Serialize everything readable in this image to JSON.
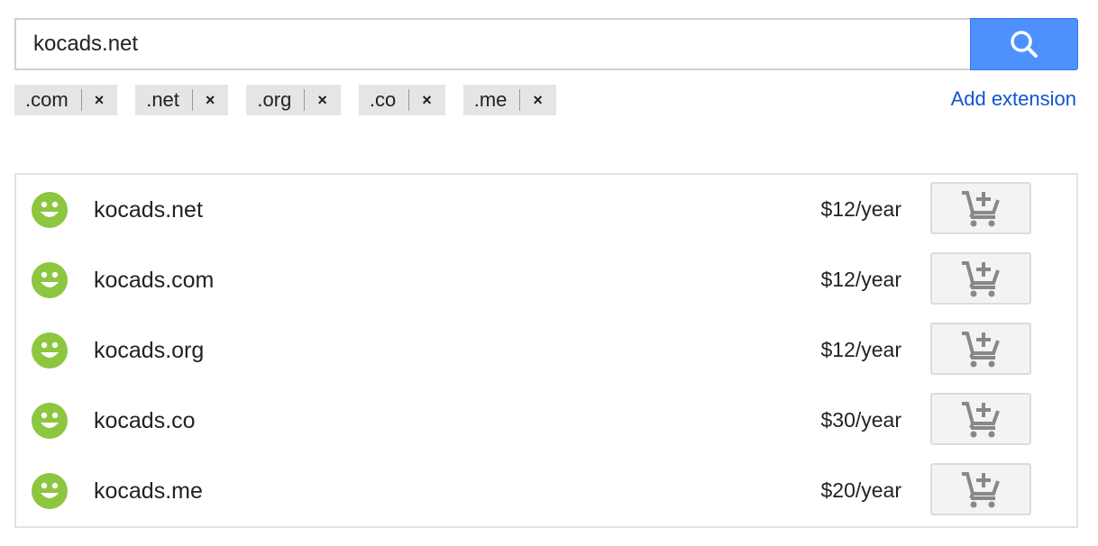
{
  "search": {
    "value": "kocads.net",
    "button_icon": "search-icon"
  },
  "extensions": [
    ".com",
    ".net",
    ".org",
    ".co",
    ".me"
  ],
  "remove_label": "×",
  "add_extension_label": "Add extension",
  "results": [
    {
      "domain": "kocads.net",
      "price": "$12/year",
      "status": "available"
    },
    {
      "domain": "kocads.com",
      "price": "$12/year",
      "status": "available"
    },
    {
      "domain": "kocads.org",
      "price": "$12/year",
      "status": "available"
    },
    {
      "domain": "kocads.co",
      "price": "$30/year",
      "status": "available"
    },
    {
      "domain": "kocads.me",
      "price": "$20/year",
      "status": "available"
    }
  ],
  "colors": {
    "accent": "#4d90fe",
    "link": "#1155cc",
    "available": "#8dc63f",
    "cart": "#888888"
  }
}
